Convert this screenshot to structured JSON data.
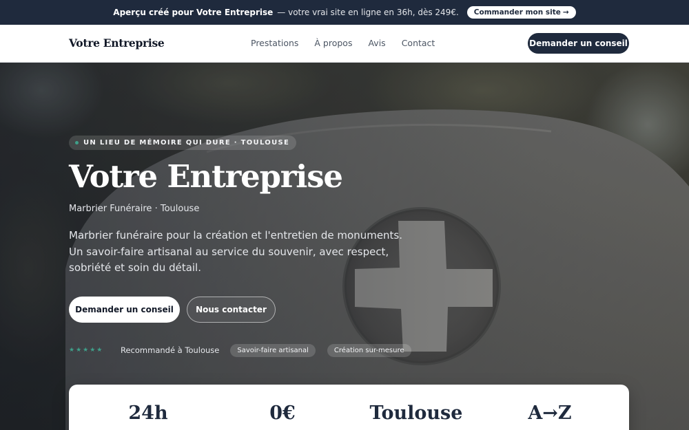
{
  "promo": {
    "lead": "Aperçu créé pour Votre Entreprise",
    "rest": "— votre vrai site en ligne en 36h, dès 249€.",
    "cta": "Commander mon site",
    "cta_arrow": "→"
  },
  "nav": {
    "brand": "Votre Entreprise",
    "links": [
      "Prestations",
      "À propos",
      "Avis",
      "Contact"
    ],
    "cta": "Demander un conseil"
  },
  "hero": {
    "kicker": "UN LIEU DE MÉMOIRE QUI DURE · TOULOUSE",
    "title": "Votre Entreprise",
    "subtitle": "Marbrier Funéraire · Toulouse",
    "description": "Marbrier funéraire pour la création et l'entretien de monuments. Un savoir-faire artisanal au service du souvenir, avec respect, sobriété et soin du détail.",
    "primary_cta": "Demander un conseil",
    "secondary_cta": "Nous contacter",
    "stars": "★★★★★",
    "rating": 5,
    "trust_text": "Recommandé à Toulouse",
    "chips": [
      "Savoir-faire artisanal",
      "Création sur-mesure"
    ]
  },
  "stats": [
    "24h",
    "0€",
    "Toulouse",
    "A→Z"
  ],
  "colors": {
    "navy": "#1f2a3d",
    "accent": "#3fa08a",
    "white": "#ffffff"
  },
  "icons": {
    "kicker_dot": "dot-icon",
    "stars": "star-icon"
  }
}
